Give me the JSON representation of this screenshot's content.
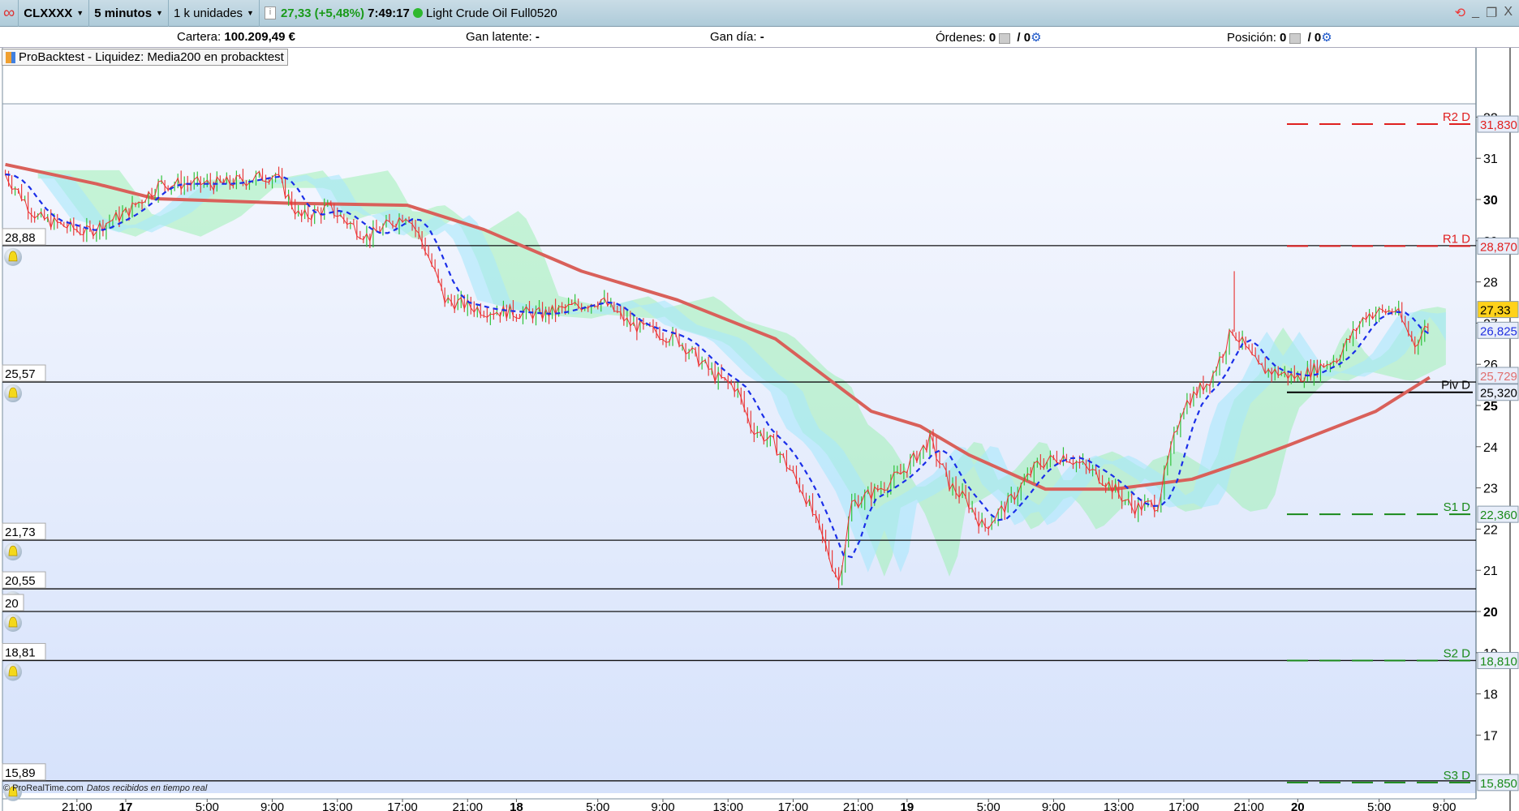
{
  "topbar": {
    "symbol": "CLXXXX",
    "timeframe": "5 minutos",
    "units": "1 k unidades",
    "price_change": "27,33 (+5,48%)",
    "time": "7:49:17",
    "instrument": "Light Crude Oil Full0520"
  },
  "info": {
    "cartera_label": "Cartera:",
    "cartera_value": "100.209,49 €",
    "gan_latente_label": "Gan latente:",
    "gan_latente_value": "-",
    "gan_dia_label": "Gan día:",
    "gan_dia_value": "-",
    "ordenes_label": "Órdenes:",
    "ordenes_value": "0",
    "ordenes_value2": "/ 0",
    "posicion_label": "Posición:",
    "posicion_value": "0",
    "posicion_value2": "/ 0"
  },
  "legend": {
    "label": "ProBacktest - Liquidez: Media200 en probacktest"
  },
  "footer": {
    "copyright": "© ProRealTime.com",
    "status": "Datos recibidos en tiempo real"
  },
  "colors": {
    "up": "#2fc23a",
    "down": "#e83c3c",
    "ma200": "#d9605a",
    "tenkan": "#1a2ee8",
    "price_line": "#f03030",
    "cloud_green": "#9ef0b4",
    "cloud_blue": "#a8e8fb",
    "resistance": "#e02020",
    "support": "#1a8a1a"
  },
  "chart_data": {
    "type": "candlestick",
    "y_ticks": [
      {
        "v": 32,
        "l": "32"
      },
      {
        "v": 31,
        "l": "31"
      },
      {
        "v": 30,
        "l": "30",
        "bold": true
      },
      {
        "v": 29,
        "l": "29"
      },
      {
        "v": 28,
        "l": "28"
      },
      {
        "v": 27,
        "l": "27"
      },
      {
        "v": 26,
        "l": "26"
      },
      {
        "v": 25,
        "l": "25",
        "bold": true
      },
      {
        "v": 24,
        "l": "24"
      },
      {
        "v": 23,
        "l": "23"
      },
      {
        "v": 22,
        "l": "22"
      },
      {
        "v": 21,
        "l": "21"
      },
      {
        "v": 20,
        "l": "20",
        "bold": true
      },
      {
        "v": 19,
        "l": "19"
      },
      {
        "v": 18,
        "l": "18"
      },
      {
        "v": 17,
        "l": "17"
      }
    ],
    "x_ticks": [
      {
        "h": -3,
        "l": "21:00"
      },
      {
        "h": 0,
        "l": "17",
        "bold": true
      },
      {
        "h": 5,
        "l": "5:00"
      },
      {
        "h": 9,
        "l": "9:00"
      },
      {
        "h": 13,
        "l": "13:00"
      },
      {
        "h": 17,
        "l": "17:00"
      },
      {
        "h": 21,
        "l": "21:00"
      },
      {
        "h": 24,
        "l": "18",
        "bold": true
      },
      {
        "h": 29,
        "l": "5:00"
      },
      {
        "h": 33,
        "l": "9:00"
      },
      {
        "h": 37,
        "l": "13:00"
      },
      {
        "h": 41,
        "l": "17:00"
      },
      {
        "h": 45,
        "l": "21:00"
      },
      {
        "h": 48,
        "l": "19",
        "bold": true
      },
      {
        "h": 53,
        "l": "5:00"
      },
      {
        "h": 57,
        "l": "9:00"
      },
      {
        "h": 61,
        "l": "13:00"
      },
      {
        "h": 65,
        "l": "17:00"
      },
      {
        "h": 69,
        "l": "21:00"
      },
      {
        "h": 72,
        "l": "20",
        "bold": true
      },
      {
        "h": 77,
        "l": "5:00"
      },
      {
        "h": 81,
        "l": "9:00"
      }
    ],
    "price_path": [
      [
        -7.4,
        30.61
      ],
      [
        -5.4,
        29.55
      ],
      [
        -2.4,
        29.2
      ],
      [
        0,
        29.67
      ],
      [
        2.1,
        30.38
      ],
      [
        6,
        30.38
      ],
      [
        9.2,
        30.61
      ],
      [
        10.7,
        29.55
      ],
      [
        12.5,
        29.79
      ],
      [
        14.9,
        29.08
      ],
      [
        17.3,
        29.67
      ],
      [
        18.5,
        28.73
      ],
      [
        19.6,
        27.56
      ],
      [
        22,
        27.32
      ],
      [
        25.6,
        27.21
      ],
      [
        29.2,
        27.56
      ],
      [
        31,
        26.97
      ],
      [
        33.9,
        26.62
      ],
      [
        36.3,
        25.68
      ],
      [
        37.5,
        25.44
      ],
      [
        38.4,
        24.5
      ],
      [
        39.9,
        24.03
      ],
      [
        41.7,
        22.86
      ],
      [
        42.9,
        21.68
      ],
      [
        43.8,
        20.74
      ],
      [
        44.6,
        22.62
      ],
      [
        45.8,
        22.86
      ],
      [
        47.6,
        23.33
      ],
      [
        49.4,
        24.15
      ],
      [
        50.6,
        23.09
      ],
      [
        51.8,
        22.62
      ],
      [
        52.7,
        22.03
      ],
      [
        54.2,
        22.62
      ],
      [
        56,
        23.56
      ],
      [
        57.7,
        23.8
      ],
      [
        60.1,
        23.21
      ],
      [
        61.9,
        22.51
      ],
      [
        63.4,
        22.62
      ],
      [
        64.9,
        24.97
      ],
      [
        66.7,
        25.68
      ],
      [
        68,
        26.85
      ],
      [
        69.6,
        25.91
      ],
      [
        72,
        25.68
      ],
      [
        74.4,
        26.15
      ],
      [
        76.2,
        27.21
      ],
      [
        78,
        27.32
      ],
      [
        79.2,
        26.5
      ],
      [
        80.2,
        27.09
      ]
    ],
    "ma200": [
      [
        -7.4,
        30.85
      ],
      [
        -1.8,
        30.38
      ],
      [
        1.8,
        30.02
      ],
      [
        10.1,
        29.91
      ],
      [
        17.3,
        29.86
      ],
      [
        22,
        29.27
      ],
      [
        28,
        28.26
      ],
      [
        33.9,
        27.56
      ],
      [
        39.9,
        26.62
      ],
      [
        45.8,
        24.86
      ],
      [
        48.8,
        24.5
      ],
      [
        51.8,
        23.8
      ],
      [
        56.5,
        22.97
      ],
      [
        60.7,
        22.97
      ],
      [
        65.5,
        23.21
      ],
      [
        69,
        23.68
      ],
      [
        71.4,
        24.03
      ],
      [
        76.8,
        24.86
      ],
      [
        80.1,
        25.68
      ]
    ],
    "spike": {
      "h": 68.1,
      "high": 28.26
    },
    "alert_lines": [
      {
        "v": 28.88,
        "l": "28,88"
      },
      {
        "v": 25.57,
        "l": "25,57"
      },
      {
        "v": 21.73,
        "l": "21,73"
      },
      {
        "v": 20.55,
        "l": "20,55"
      },
      {
        "v": 20,
        "l": "20"
      },
      {
        "v": 18.81,
        "l": "18,81"
      },
      {
        "v": 15.89,
        "l": "15,89"
      }
    ],
    "pivots": [
      {
        "name": "R2 D",
        "v": 31.83,
        "l": "31,830",
        "kind": "resistance"
      },
      {
        "name": "R1 D",
        "v": 28.87,
        "l": "28,870",
        "kind": "resistance"
      },
      {
        "name": "Piv D",
        "v": 25.32,
        "l": "25,320",
        "kind": "pivot"
      },
      {
        "name": "S1 D",
        "v": 22.36,
        "l": "22,360",
        "kind": "support"
      },
      {
        "name": "S2 D",
        "v": 18.81,
        "l": "18,810",
        "kind": "support"
      },
      {
        "name": "S3 D",
        "v": 15.85,
        "l": "15,850",
        "kind": "support"
      }
    ],
    "axis_labels": [
      {
        "v": 27.33,
        "l": "27,33",
        "bg": "#ffd21a",
        "fg": "#000"
      },
      {
        "v": 26.825,
        "l": "26,825",
        "bg": "#e8eefa",
        "fg": "#2030e0"
      },
      {
        "v": 25.729,
        "l": "25,729",
        "bg": "#e8eefa",
        "fg": "#e07070"
      }
    ]
  }
}
